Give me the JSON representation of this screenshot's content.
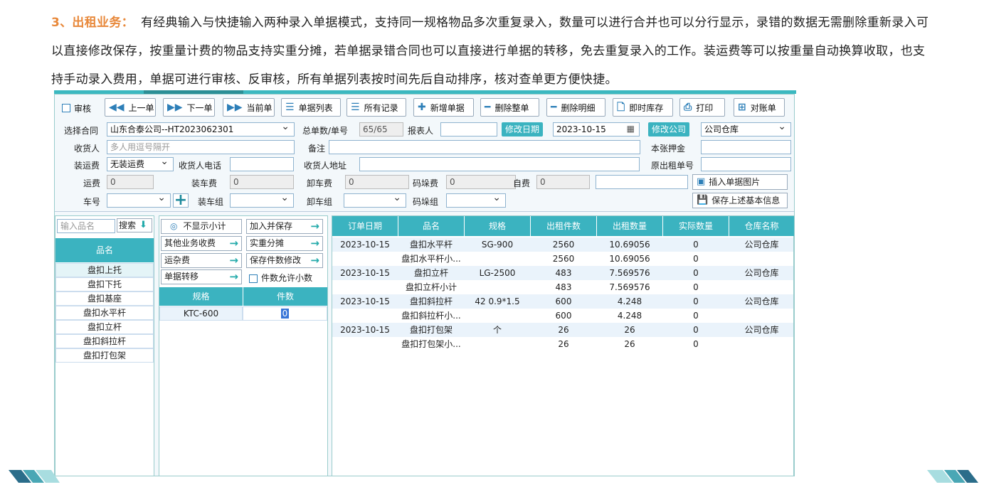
{
  "intro": {
    "heading": "3、出租业务：",
    "text": "有经典输入与快捷输入两种录入单据模式，支持同一规格物品多次重复录入，数量可以进行合并也可以分行显示，录错的数据无需删除重新录入可以直接修改保存，按重量计费的物品支持实重分摊，若单据录错合同也可以直接进行单据的转移，免去重复录入的工作。装运费等可以按重量自动换算收取，也支持手动录入费用，单据可进行审核、反审核，所有单据列表按时间先后自动排序，核对查单更方便快捷。"
  },
  "toolbar": {
    "audit": "审核",
    "prev": "上一单",
    "next": "下一单",
    "current": "当前单",
    "list": "单据列表",
    "all_records": "所有记录",
    "new": "新增单据",
    "delete_all": "删除整单",
    "delete_detail": "删除明细",
    "stock": "即时库存",
    "print": "打印",
    "reconcile": "对账单"
  },
  "form": {
    "contract_label": "选择合同",
    "contract_value": "山东合泰公司--HT2023062301",
    "total_label": "总单数/单号",
    "total_value": "65/65",
    "reporter_label": "报表人",
    "reporter_value": "",
    "modify_date_btn": "修改日期",
    "date_value": "2023-10-15",
    "modify_company_btn": "修改公司",
    "warehouse_value": "公司仓库",
    "receiver_label": "收货人",
    "receiver_placeholder": "多人用逗号隔开",
    "remark_label": "备注",
    "deposit_label": "本张押金",
    "ship_fee_label": "装运费",
    "ship_fee_value": "无装运费",
    "receiver_phone_label": "收货人电话",
    "receiver_addr_label": "收货人地址",
    "orig_no_label": "原出租单号",
    "freight_label": "运费",
    "freight_value": "0",
    "load_fee_label": "装车费",
    "load_fee_value": "0",
    "unload_fee_label": "卸车费",
    "unload_fee_value": "0",
    "stack_fee_label": "码垛费",
    "stack_fee_value": "0",
    "self_fee_label": "自费",
    "self_fee_value": "0",
    "insert_image_btn": "插入单据图片",
    "car_label": "车号",
    "load_group_label": "装车组",
    "unload_group_label": "卸车组",
    "stack_group_label": "码垛组",
    "save_basic_btn": "保存上述基本信息"
  },
  "left_panel": {
    "search_placeholder": "输入品名",
    "search_btn": "搜索",
    "header": "品名",
    "items": [
      "盘扣上托",
      "盘扣下托",
      "盘扣基座",
      "盘扣水平杆",
      "盘扣立杆",
      "盘扣斜拉杆",
      "盘扣打包架"
    ]
  },
  "mid_panel": {
    "hide_subtotal": "不显示小计",
    "add_save": "加入并保存",
    "other_fee": "其他业务收费",
    "weight_split": "实重分摊",
    "misc_fee": "运杂费",
    "save_qty_modify": "保存件数修改",
    "transfer": "单据转移",
    "allow_decimal": "件数允许小数",
    "col_spec": "规格",
    "col_qty": "件数",
    "row_spec": "KTC-600",
    "row_qty": "0"
  },
  "grid": {
    "columns": [
      "订单日期",
      "品名",
      "规格",
      "出租件数",
      "出租数量",
      "实际数量",
      "仓库名称"
    ],
    "rows": [
      [
        "2023-10-15",
        "盘扣水平杆",
        "SG-900",
        "2560",
        "10.69056",
        "0",
        "公司仓库"
      ],
      [
        "",
        "盘扣水平杆小...",
        "",
        "2560",
        "10.69056",
        "0",
        ""
      ],
      [
        "2023-10-15",
        "盘扣立杆",
        "LG-2500",
        "483",
        "7.569576",
        "0",
        "公司仓库"
      ],
      [
        "",
        "盘扣立杆小计",
        "",
        "483",
        "7.569576",
        "0",
        ""
      ],
      [
        "2023-10-15",
        "盘扣斜拉杆",
        "42  0.9*1.5",
        "600",
        "4.248",
        "0",
        "公司仓库"
      ],
      [
        "",
        "盘扣斜拉杆小...",
        "",
        "600",
        "4.248",
        "0",
        ""
      ],
      [
        "2023-10-15",
        "盘扣打包架",
        "个",
        "26",
        "26",
        "0",
        "公司仓库"
      ],
      [
        "",
        "盘扣打包架小...",
        "",
        "26",
        "26",
        "0",
        ""
      ]
    ]
  },
  "colors": {
    "accent": "#3bb3c0",
    "heading": "#e8883a"
  }
}
